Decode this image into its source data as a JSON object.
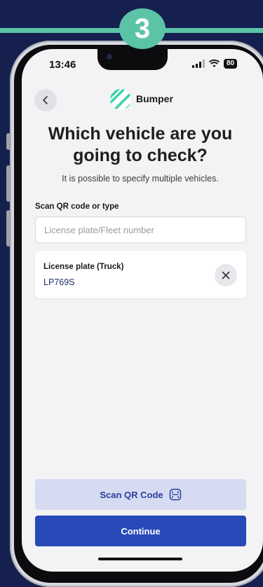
{
  "step": {
    "number": "3"
  },
  "status_bar": {
    "time": "13:46",
    "battery": "80"
  },
  "header": {
    "brand": "Bumper",
    "back_icon": "chevron-left-icon",
    "logo_icon": "striped-circle-logo"
  },
  "title": "Which vehicle are you going to check?",
  "subtitle": "It is possible to specify multiple vehicles.",
  "search": {
    "label": "Scan QR code or type",
    "placeholder": "License plate/Fleet number",
    "value": ""
  },
  "vehicles": [
    {
      "label": "License plate (Truck)",
      "value": "LP769S"
    }
  ],
  "actions": {
    "scan_label": "Scan QR Code",
    "continue_label": "Continue"
  },
  "colors": {
    "background": "#15204f",
    "accent_teal": "#5cc4a6",
    "primary": "#2849b8",
    "secondary_button": "#d6dbf1"
  }
}
